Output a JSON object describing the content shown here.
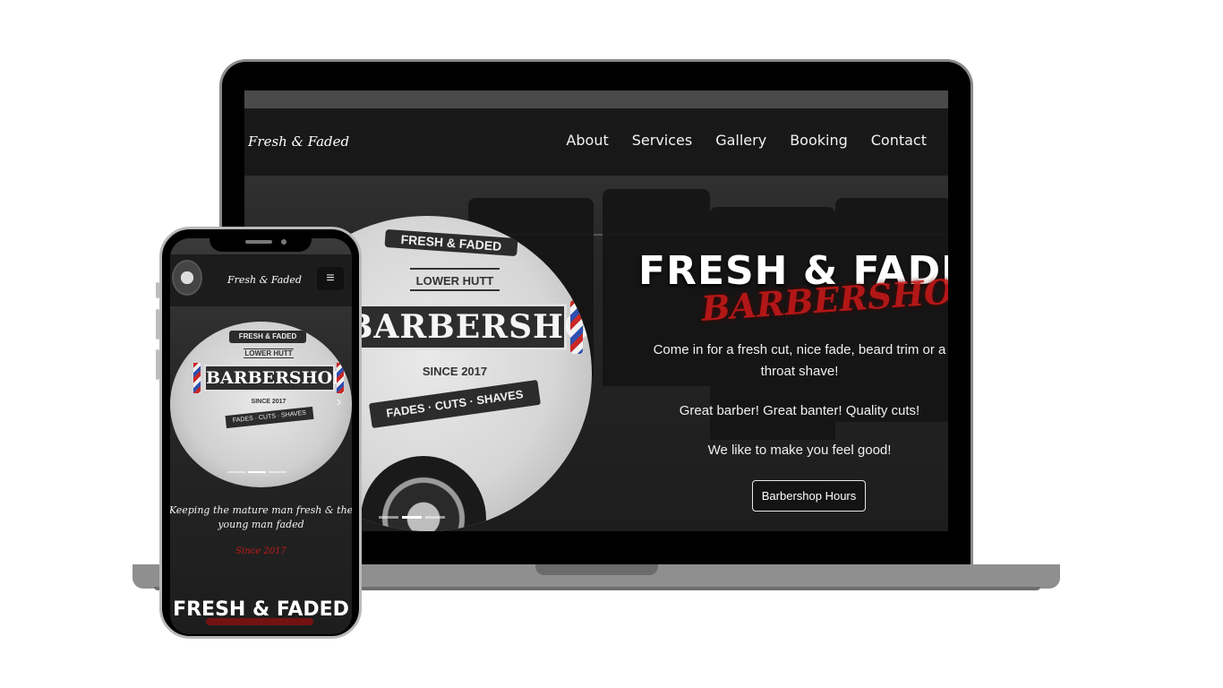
{
  "laptop_site": {
    "brand": "Fresh & Faded",
    "nav": [
      "About",
      "Services",
      "Gallery",
      "Booking",
      "Contact"
    ],
    "hero": {
      "title": "FRESH & FADED",
      "script": "BARBERSHOP.",
      "line1": "Come in for a fresh cut, nice fade, beard trim or a throat shave!",
      "line2": "Great barber! Great banter! Quality cuts!",
      "line3": "We like to make you feel good!",
      "button": "Barbershop Hours"
    },
    "sign": {
      "banner": "FRESH & FADED",
      "location": "LOWER HUTT",
      "main": "BARBERSHOP",
      "since": "SINCE 2017",
      "ribbon": "FADES · CUTS · SHAVES"
    },
    "carousel_arrow": "›"
  },
  "phone_site": {
    "brand": "Fresh & Faded",
    "menu_icon": "≡",
    "sign": {
      "banner": "FRESH & FADED",
      "location": "LOWER HUTT",
      "main": "BARBERSHOP",
      "since": "SINCE 2017",
      "ribbon": "FADES · CUTS · SHAVES"
    },
    "carousel_arrow": "›",
    "tagline": "Keeping the mature man fresh & the young man faded",
    "since": "Since 2017",
    "title": "FRESH & FADED"
  },
  "colors": {
    "accent_red": "#c31818",
    "device_frame": "#000000",
    "device_base": "#8f8f8f"
  }
}
